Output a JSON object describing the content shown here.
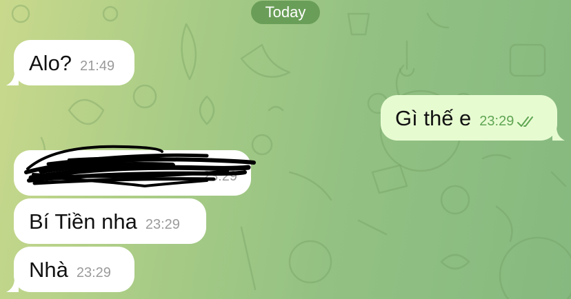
{
  "chat": {
    "date_label": "Today",
    "messages": [
      {
        "direction": "in",
        "text": "Alo?",
        "time": "21:49"
      },
      {
        "direction": "out",
        "text": "Gì thế e",
        "time": "23:29",
        "status": "read-double-check-icon"
      },
      {
        "direction": "in",
        "text": "",
        "time": "23:29",
        "redacted": true
      },
      {
        "direction": "in",
        "text": "Bí Tiền nha",
        "time": "23:29"
      },
      {
        "direction": "in",
        "text": "Nhà",
        "time": "23:29"
      }
    ]
  },
  "colors": {
    "incoming_bubble": "#ffffff",
    "outgoing_bubble": "#e7fbd1",
    "outgoing_time": "#5ea552",
    "date_pill": "#609650"
  }
}
